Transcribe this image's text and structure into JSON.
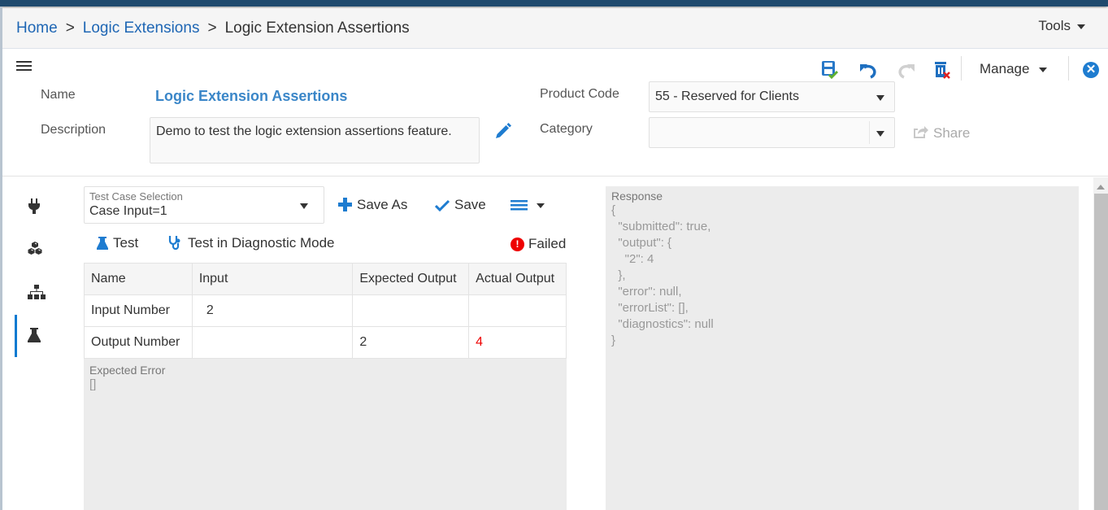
{
  "breadcrumb": {
    "items": [
      {
        "label": "Home"
      },
      {
        "label": "Logic Extensions"
      },
      {
        "label": "Logic Extension Assertions"
      }
    ],
    "separator": ">"
  },
  "tools_menu": {
    "label": "Tools"
  },
  "toolbar": {
    "icons": [
      "save-icon",
      "undo-icon",
      "redo-icon",
      "delete-icon"
    ],
    "manage_label": "Manage",
    "close_glyph": "✕"
  },
  "form": {
    "name_label": "Name",
    "name_value": "Logic Extension Assertions",
    "description_label": "Description",
    "description_value": "Demo to test the logic extension assertions feature.",
    "product_code_label": "Product Code",
    "product_code_value": "55 - Reserved for Clients",
    "category_label": "Category",
    "category_value": "",
    "share_label": "Share"
  },
  "side_nav": {
    "items": [
      {
        "icon": "plug-icon",
        "active": false
      },
      {
        "icon": "cubes-icon",
        "active": false
      },
      {
        "icon": "sitemap-icon",
        "active": false
      },
      {
        "icon": "flask-icon",
        "active": true
      }
    ]
  },
  "test_case": {
    "selection_label": "Test Case Selection",
    "selection_value": "Case Input=1",
    "save_as_label": "Save As",
    "save_label": "Save",
    "test_label": "Test",
    "diagnostic_label": "Test in Diagnostic Mode",
    "status_label": "Failed",
    "status_glyph": "!"
  },
  "grid": {
    "columns": [
      "Name",
      "Input",
      "Expected Output",
      "Actual Output"
    ],
    "rows": [
      {
        "name": "Input Number",
        "input": "2",
        "expected": "",
        "actual": ""
      },
      {
        "name": "Output Number",
        "input": "",
        "expected": "2",
        "actual": "4"
      }
    ],
    "colors": {
      "mismatch": "#e00000"
    }
  },
  "expected_error": {
    "title": "Expected Error",
    "value": "[]"
  },
  "response": {
    "title": "Response",
    "body": "{\n  \"submitted\": true,\n  \"output\": {\n    \"2\": 4\n  },\n  \"error\": null,\n  \"errorList\": [],\n  \"diagnostics\": null\n}"
  },
  "colors": {
    "accent": "#1e7cd0",
    "link": "#1e66b4",
    "top_bar": "#1f4a6e",
    "error": "#e00000"
  }
}
